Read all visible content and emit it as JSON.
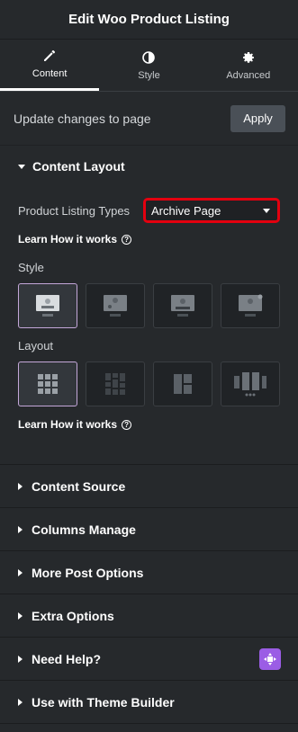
{
  "header": {
    "title": "Edit Woo Product Listing"
  },
  "tabs": [
    {
      "label": "Content",
      "icon": "pencil-icon",
      "active": true
    },
    {
      "label": "Style",
      "icon": "contrast-icon",
      "active": false
    },
    {
      "label": "Advanced",
      "icon": "gear-icon",
      "active": false
    }
  ],
  "update": {
    "text": "Update changes to page",
    "button": "Apply"
  },
  "content_layout": {
    "title": "Content Layout",
    "listing_type_label": "Product Listing Types",
    "listing_type_value": "Archive Page",
    "learn_label": "Learn How it works",
    "style_label": "Style",
    "layout_label": "Layout",
    "learn_label_2": "Learn How it works"
  },
  "sections": [
    {
      "title": "Content Source"
    },
    {
      "title": "Columns Manage"
    },
    {
      "title": "More Post Options"
    },
    {
      "title": "Extra Options"
    },
    {
      "title": "Need Help?"
    },
    {
      "title": "Use with Theme Builder"
    }
  ],
  "colors": {
    "accent_red": "#e3000f",
    "help_badge": "#9b5de5",
    "selected_border": "#c4a7d9"
  }
}
